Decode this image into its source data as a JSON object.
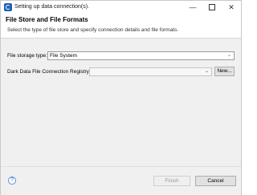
{
  "window": {
    "title": "Setting up data connection(s)."
  },
  "banner": {
    "title": "File Store and File Formats",
    "description": "Select the type of file store and specify connection details and file formats."
  },
  "form": {
    "storage_type_label": "File storage type:",
    "storage_type_value": "File System",
    "registry_label": "Dark Data File Connection Registry",
    "registry_value": "",
    "new_button_label": "New..."
  },
  "footer": {
    "help_label": "?",
    "finish_label": "Finish",
    "cancel_label": "Cancel"
  },
  "icons": {
    "app": "eclipse-icon",
    "minimize": "minimize-icon",
    "maximize": "maximize-icon",
    "close": "close-icon",
    "dropdown": "chevron-down-icon",
    "help": "help-icon"
  }
}
